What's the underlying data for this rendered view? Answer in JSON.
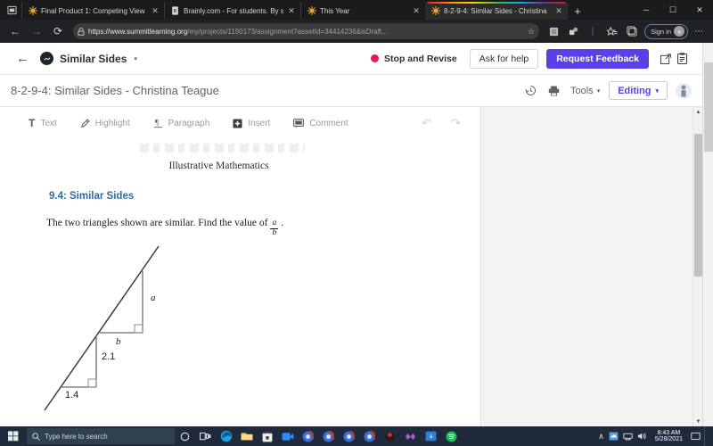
{
  "browser": {
    "tabs": [
      {
        "title": "Final Product 1: Competing View",
        "favicon": "summit-star-icon",
        "active": false
      },
      {
        "title": "Brainly.com - For students. By st",
        "favicon": "brainly-icon",
        "active": false
      },
      {
        "title": "This Year",
        "favicon": "summit-star-icon",
        "active": false
      },
      {
        "title": "8-2-9-4: Similar Sides - Christina",
        "favicon": "summit-star-icon",
        "active": true
      }
    ],
    "new_tab_label": "+",
    "window_controls": {
      "minimize": "─",
      "maximize": "☐",
      "close": "✕"
    },
    "nav": {
      "back": "←",
      "forward": "→",
      "reload": "⟳"
    },
    "url_secure": "https://www.summitlearning.org",
    "url_path": "/my/projects/1190173/assignment?assetId=34414236&isDraft...",
    "sign_in_label": "Sign in",
    "overflow_label": "⋯"
  },
  "app_header": {
    "back_arrow": "←",
    "title": "Similar Sides",
    "dropdown_caret": "▾",
    "status_label": "Stop and Revise",
    "status_color": "#e01e5a",
    "ask_for_help_label": "Ask for help",
    "request_feedback_label": "Request Feedback",
    "open_external_icon": "external-link-icon",
    "clipboard_icon": "clipboard-icon"
  },
  "doc_bar": {
    "title": "8-2-9-4: Similar Sides - Christina Teague",
    "history_icon": "version-history-icon",
    "print_icon": "print-icon",
    "tools_label": "Tools",
    "tools_caret": "▾",
    "editing_label": "Editing",
    "editing_caret": "▾",
    "avatar": "user-avatar"
  },
  "edit_toolbar": {
    "items": [
      {
        "icon": "text-icon",
        "glyph": "T",
        "label": "Text"
      },
      {
        "icon": "highlighter-icon",
        "glyph": "✐",
        "label": "Highlight"
      },
      {
        "icon": "paragraph-icon",
        "glyph": "¶",
        "label": "Paragraph"
      },
      {
        "icon": "insert-plus-icon",
        "glyph": "+",
        "label": "Insert"
      },
      {
        "icon": "comment-icon",
        "glyph": "▭",
        "label": "Comment"
      }
    ],
    "undo": "↶",
    "redo": "↷"
  },
  "document": {
    "publisher": "Illustrative Mathematics",
    "section_title": "9.4: Similar Sides",
    "prompt_prefix": "The two triangles shown are similar. Find the value of",
    "fraction_numerator": "a",
    "fraction_denominator": "b",
    "prompt_suffix": "."
  },
  "chart_data": {
    "type": "diagram",
    "title": "Two similar right triangles on a common line",
    "labels": [
      {
        "text": "a",
        "role": "vertical-leg-large-triangle",
        "italic": true
      },
      {
        "text": "b",
        "role": "horizontal-leg-large-triangle",
        "italic": true
      },
      {
        "text": "2.1",
        "role": "vertical-leg-small-triangle",
        "italic": false
      },
      {
        "text": "1.4",
        "role": "horizontal-leg-small-triangle",
        "italic": false
      }
    ],
    "small_triangle": {
      "horizontal_leg": 1.4,
      "vertical_leg": 2.1
    },
    "large_triangle": {
      "horizontal_leg": "b",
      "vertical_leg": "a"
    },
    "right_angle_markers": 2,
    "line_color": "#3b3b3b"
  },
  "taskbar": {
    "start_icon": "windows-start-icon",
    "search_placeholder": "Type here to search",
    "search_icon": "search-icon",
    "cortana_icon": "cortana-circle-icon",
    "taskview_icon": "task-view-icon",
    "pinned": [
      "edge-icon",
      "file-explorer-icon",
      "store-icon",
      "zoom-icon",
      "chrome-icon",
      "chrome-icon",
      "chrome-icon",
      "chrome-icon",
      "discord-icon",
      "game-icon",
      "arcade-icon",
      "spotify-icon"
    ],
    "tray_expand": "∧",
    "tray_icons": [
      "onedrive-icon",
      "network-icon",
      "volume-icon"
    ],
    "time": "8:43 AM",
    "date": "5/28/2021",
    "show_desktop": "show-desktop-button"
  }
}
